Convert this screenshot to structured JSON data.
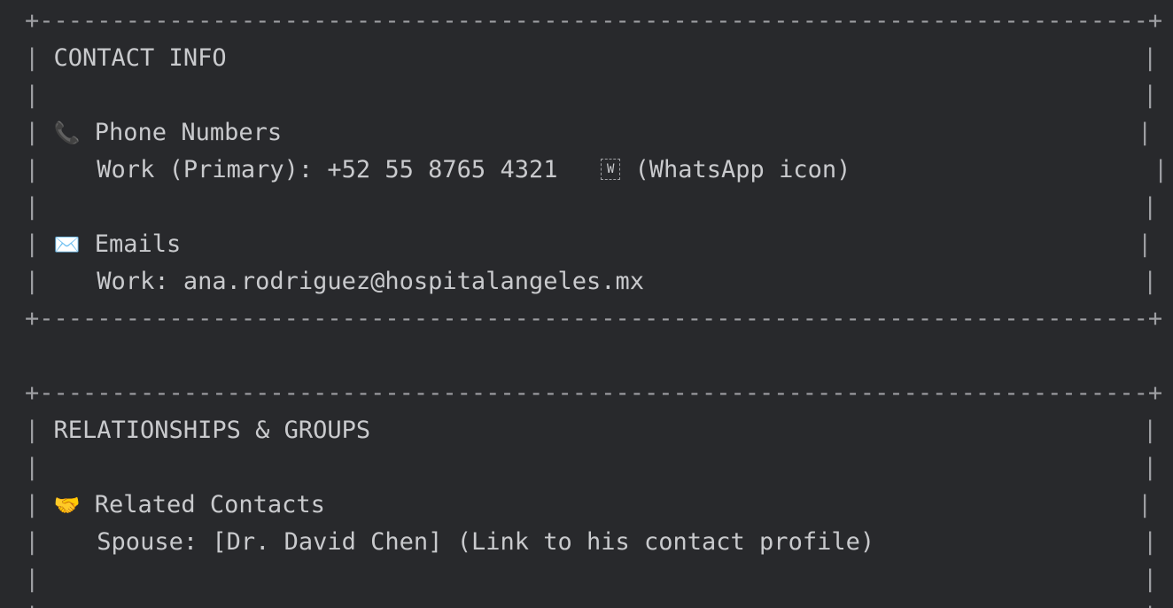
{
  "contact_info": {
    "heading": "CONTACT INFO",
    "phone_section_label": "Phone Numbers",
    "phone_icon": "phone-icon",
    "phone_entry": "Work (Primary): +52 55 8765 4321",
    "whatsapp_glyph": "W",
    "whatsapp_note": "(WhatsApp icon)",
    "email_section_label": "Emails",
    "email_icon": "envelope-icon",
    "email_entry": "Work: ana.rodriguez@hospitalangeles.mx"
  },
  "relationships": {
    "heading": "RELATIONSHIPS & GROUPS",
    "related_section_label": "Related Contacts",
    "related_icon": "handshake-icon",
    "spouse_prefix": "Spouse: ",
    "spouse_link": "[Dr. David Chen]",
    "spouse_note": " (Link to his contact profile)"
  }
}
